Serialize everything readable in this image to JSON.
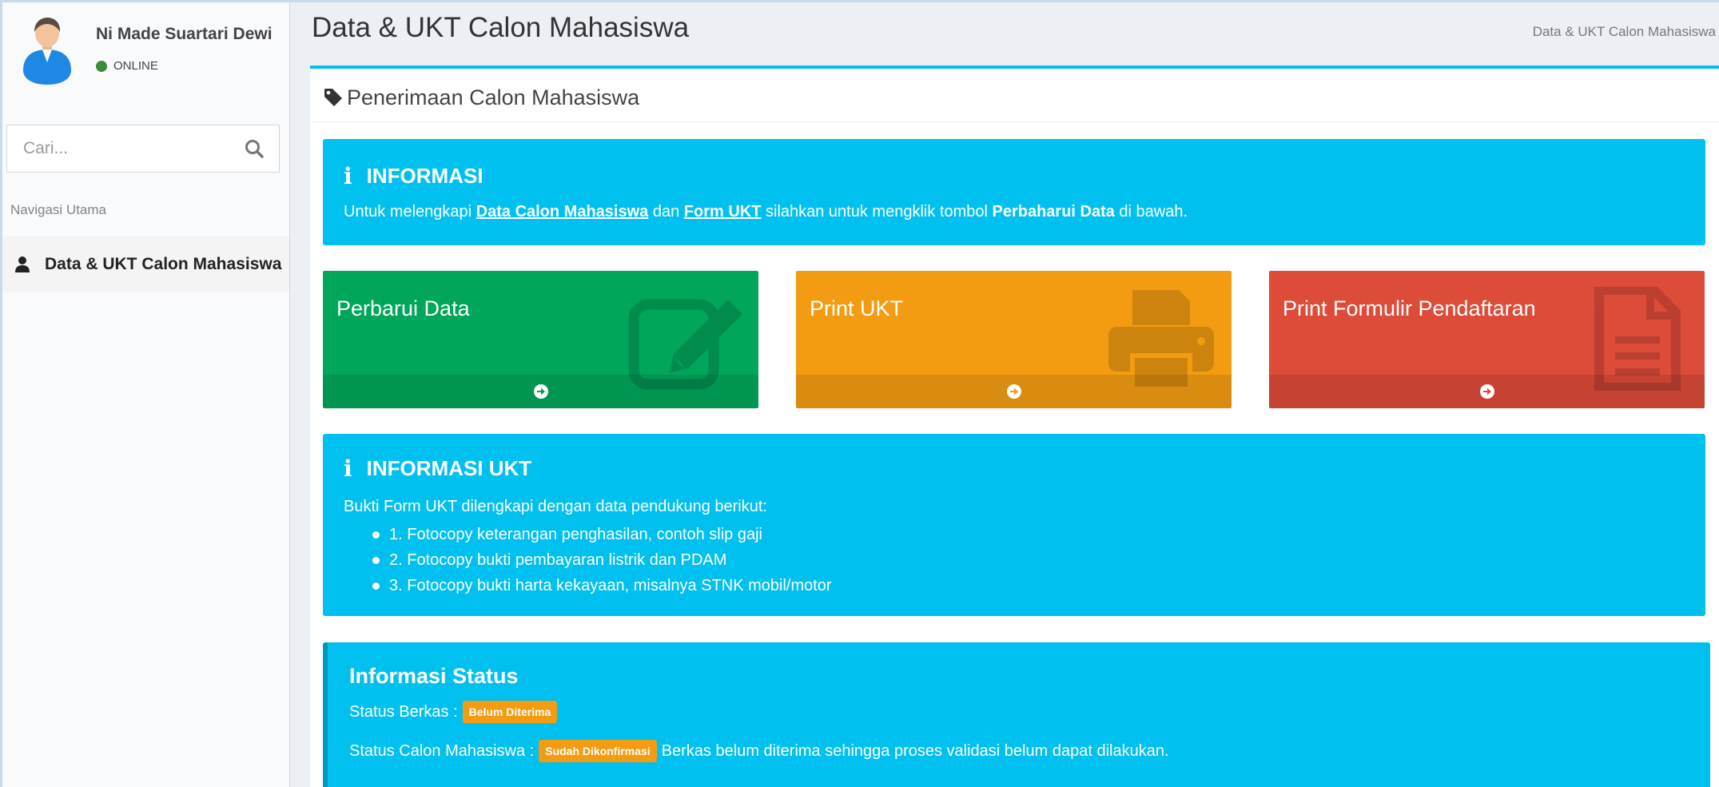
{
  "user": {
    "name": "Ni Made Suartari Dewi",
    "status": "ONLINE"
  },
  "search": {
    "placeholder": "Cari..."
  },
  "nav": {
    "header": "Navigasi Utama",
    "items": [
      {
        "label": "Data & UKT Calon Mahasiswa"
      }
    ]
  },
  "page": {
    "title": "Data & UKT Calon Mahasiswa",
    "breadcrumb": "Data & UKT Calon Mahasiswa"
  },
  "box": {
    "title": "Penerimaan Calon Mahasiswa"
  },
  "info": {
    "title": "INFORMASI",
    "text_1": "Untuk melengkapi ",
    "link_1": "Data Calon Mahasiswa",
    "text_2": " dan ",
    "link_2": "Form UKT",
    "text_3": " silahkan untuk mengklik tombol ",
    "bold_1": "Perbaharui Data",
    "text_4": " di bawah."
  },
  "tiles": [
    {
      "label": "Perbarui Data",
      "color": "#00a65a",
      "icon": "edit-icon"
    },
    {
      "label": "Print UKT",
      "color": "#f39c12",
      "icon": "printer-icon"
    },
    {
      "label": "Print Formulir Pendaftaran",
      "color": "#dd4b39",
      "icon": "document-icon"
    }
  ],
  "ukt": {
    "title": "INFORMASI UKT",
    "intro": "Bukti Form UKT dilengkapi dengan data pendukung berikut:",
    "items": [
      "1. Fotocopy keterangan penghasilan, contoh slip gaji",
      "2. Fotocopy bukti pembayaran listrik dan PDAM",
      "3. Fotocopy bukti harta kekayaan, misalnya STNK mobil/motor"
    ]
  },
  "status": {
    "title": "Informasi Status",
    "berkas_label": "Status Berkas :",
    "berkas_badge": "Belum Diterima",
    "mahasiswa_label": "Status Calon Mahasiswa :",
    "mahasiswa_badge": "Sudah Dikonfirmasi",
    "mahasiswa_note": "Berkas belum diterima sehingga proses validasi belum dapat dilakukan."
  },
  "colors": {
    "accent": "#00c0ef",
    "badge": "#f39c12",
    "online": "#3c8a3c"
  }
}
